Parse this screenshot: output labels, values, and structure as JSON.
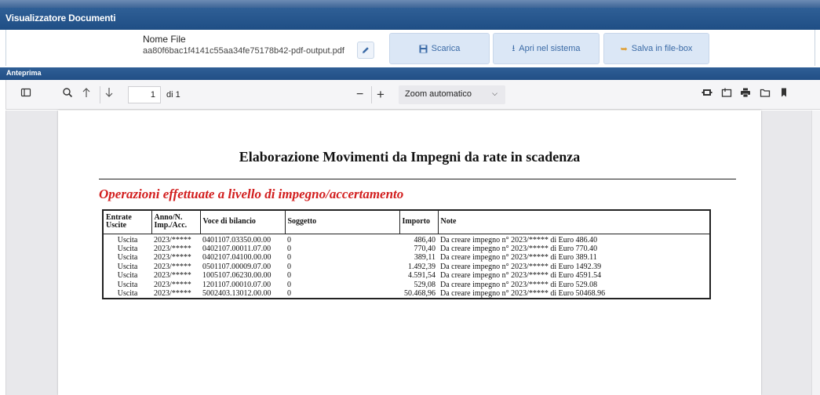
{
  "window": {
    "title": "Visualizzatore Documenti"
  },
  "file": {
    "label": "Nome File",
    "value": "aa80f6bac1f4141c55aa34fe75178b42-pdf-output.pdf"
  },
  "actions": {
    "download": "Scarica",
    "open_system": "Apri nel sistema",
    "save_filebox": "Salva in file-box"
  },
  "preview": {
    "title": "Anteprima"
  },
  "toolbar": {
    "page_current": "1",
    "page_of": "di 1",
    "zoom": "Zoom automatico"
  },
  "document": {
    "title": "Elaborazione Movimenti da Impegni da rate in scadenza",
    "subtitle": "Operazioni effettuate a livello di impegno/accertamento",
    "columns": {
      "c1": [
        "Entrate",
        "Uscite"
      ],
      "c2": [
        "Anno/N.",
        "Imp./Acc."
      ],
      "c3": "Voce di bilancio",
      "c4": "Soggetto",
      "c5": "Importo",
      "c6": "Note"
    },
    "rows": [
      {
        "tipo": "Uscita",
        "anno": "2023/*****",
        "voce": "0401107.03350.00.00",
        "soggetto": "0",
        "importo": "486,40",
        "note": "Da creare impegno n° 2023/***** di Euro 486.40"
      },
      {
        "tipo": "Uscita",
        "anno": "2023/*****",
        "voce": "0402107.00011.07.00",
        "soggetto": "0",
        "importo": "770,40",
        "note": "Da creare impegno n° 2023/***** di Euro 770.40"
      },
      {
        "tipo": "Uscita",
        "anno": "2023/*****",
        "voce": "0402107.04100.00.00",
        "soggetto": "0",
        "importo": "389,11",
        "note": "Da creare impegno n° 2023/***** di Euro 389.11"
      },
      {
        "tipo": "Uscita",
        "anno": "2023/*****",
        "voce": "0501107.00009.07.00",
        "soggetto": "0",
        "importo": "1.492,39",
        "note": "Da creare impegno n° 2023/***** di Euro 1492.39"
      },
      {
        "tipo": "Uscita",
        "anno": "2023/*****",
        "voce": "1005107.06230.00.00",
        "soggetto": "0",
        "importo": "4.591,54",
        "note": "Da creare impegno n° 2023/***** di Euro 4591.54"
      },
      {
        "tipo": "Uscita",
        "anno": "2023/*****",
        "voce": "1201107.00010.07.00",
        "soggetto": "0",
        "importo": "529,08",
        "note": "Da creare impegno n° 2023/***** di Euro 529.08"
      },
      {
        "tipo": "Uscita",
        "anno": "2023/*****",
        "voce": "5002403.13012.00.00",
        "soggetto": "0",
        "importo": "50.468,96",
        "note": "Da creare impegno n° 2023/***** di Euro 50468.96"
      }
    ]
  },
  "colors": {
    "header_blue": "#1f4e85",
    "button_bg": "#dbe7f6",
    "subtitle_red": "#d21e1e"
  }
}
